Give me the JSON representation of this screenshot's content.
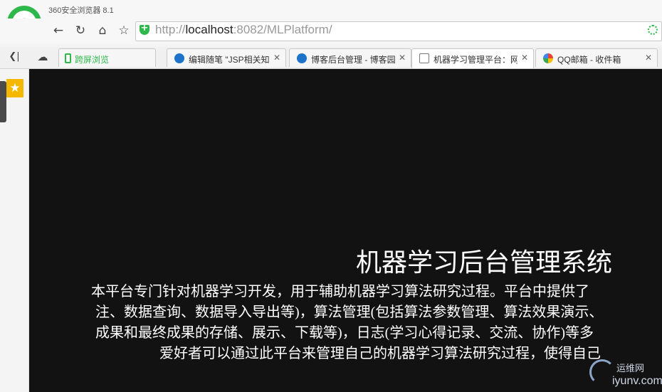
{
  "window": {
    "app_title": "360安全浏览器 8.1",
    "brand_color": "#2eb84b"
  },
  "toolbar": {
    "back_icon": "arrow-left-icon",
    "reload_icon": "reload-icon",
    "home_icon": "home-icon",
    "favorite_icon": "star-icon",
    "url_scheme": "http://",
    "url_host": "localhost",
    "url_rest": ":8082/MLPlatform/"
  },
  "tabs": [
    {
      "label": "跨屏浏览",
      "icon": "phone-icon",
      "closable": false
    },
    {
      "label": "编辑随笔 \"JSP相关知识",
      "icon": "site-icon",
      "closable": true
    },
    {
      "label": "博客后台管理 - 博客园",
      "icon": "site-icon",
      "closable": true
    },
    {
      "label": "机器学习管理平台：网",
      "icon": "page-icon",
      "closable": true,
      "active": true
    },
    {
      "label": "QQ邮箱 - 收件箱",
      "icon": "qq-mail-icon",
      "closable": true
    }
  ],
  "page": {
    "title": "机器学习后台管理系统",
    "lines": [
      "本平台专门针对机器学习开发，用于辅助机器学习算法研究过程。平台中提供了",
      "注、数据查询、数据导入导出等)，算法管理(包括算法参数管理、算法效果演示、",
      "成果和最终成果的存储、展示、下载等)，日志(学习心得记录、交流、协作)等多",
      "爱好者可以通过此平台来管理自己的机器学习算法研究过程，使得自己"
    ]
  },
  "watermark": {
    "cn": "运维网",
    "en": "iyunv.com"
  }
}
